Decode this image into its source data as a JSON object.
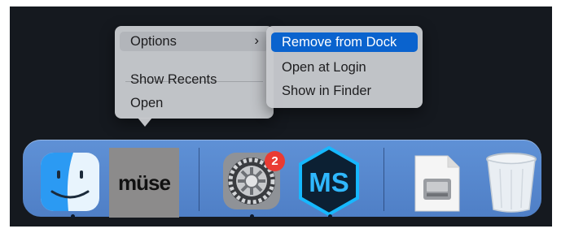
{
  "context_menu": {
    "items": [
      {
        "label": "Options",
        "has_submenu": true,
        "chevron": "›"
      },
      {
        "label": "Show Recents"
      },
      {
        "label": "Open"
      }
    ]
  },
  "submenu": {
    "items": [
      {
        "label": "Remove from Dock",
        "highlighted": true
      },
      {
        "label": "Open at Login"
      },
      {
        "label": "Show in Finder"
      }
    ]
  },
  "dock": {
    "apps": [
      {
        "name": "Finder",
        "icon": "finder-icon",
        "running": true
      },
      {
        "name": "Muse",
        "icon": "muse-icon",
        "logo_text": "müse",
        "running": false
      },
      {
        "name": "System Preferences",
        "icon": "gear-icon",
        "badge": "2",
        "running": true
      },
      {
        "name": "MS",
        "icon": "ms-hexagon-icon",
        "logo_text": "MS",
        "running": true
      },
      {
        "name": "Disk Image",
        "icon": "disk-image-icon",
        "running": false
      },
      {
        "name": "Trash",
        "icon": "trash-icon",
        "running": false
      }
    ]
  },
  "colors": {
    "dock": "#5a8ad2",
    "highlight": "#0a63ce",
    "badge": "#ea3b33",
    "desktop": "#15191f"
  }
}
